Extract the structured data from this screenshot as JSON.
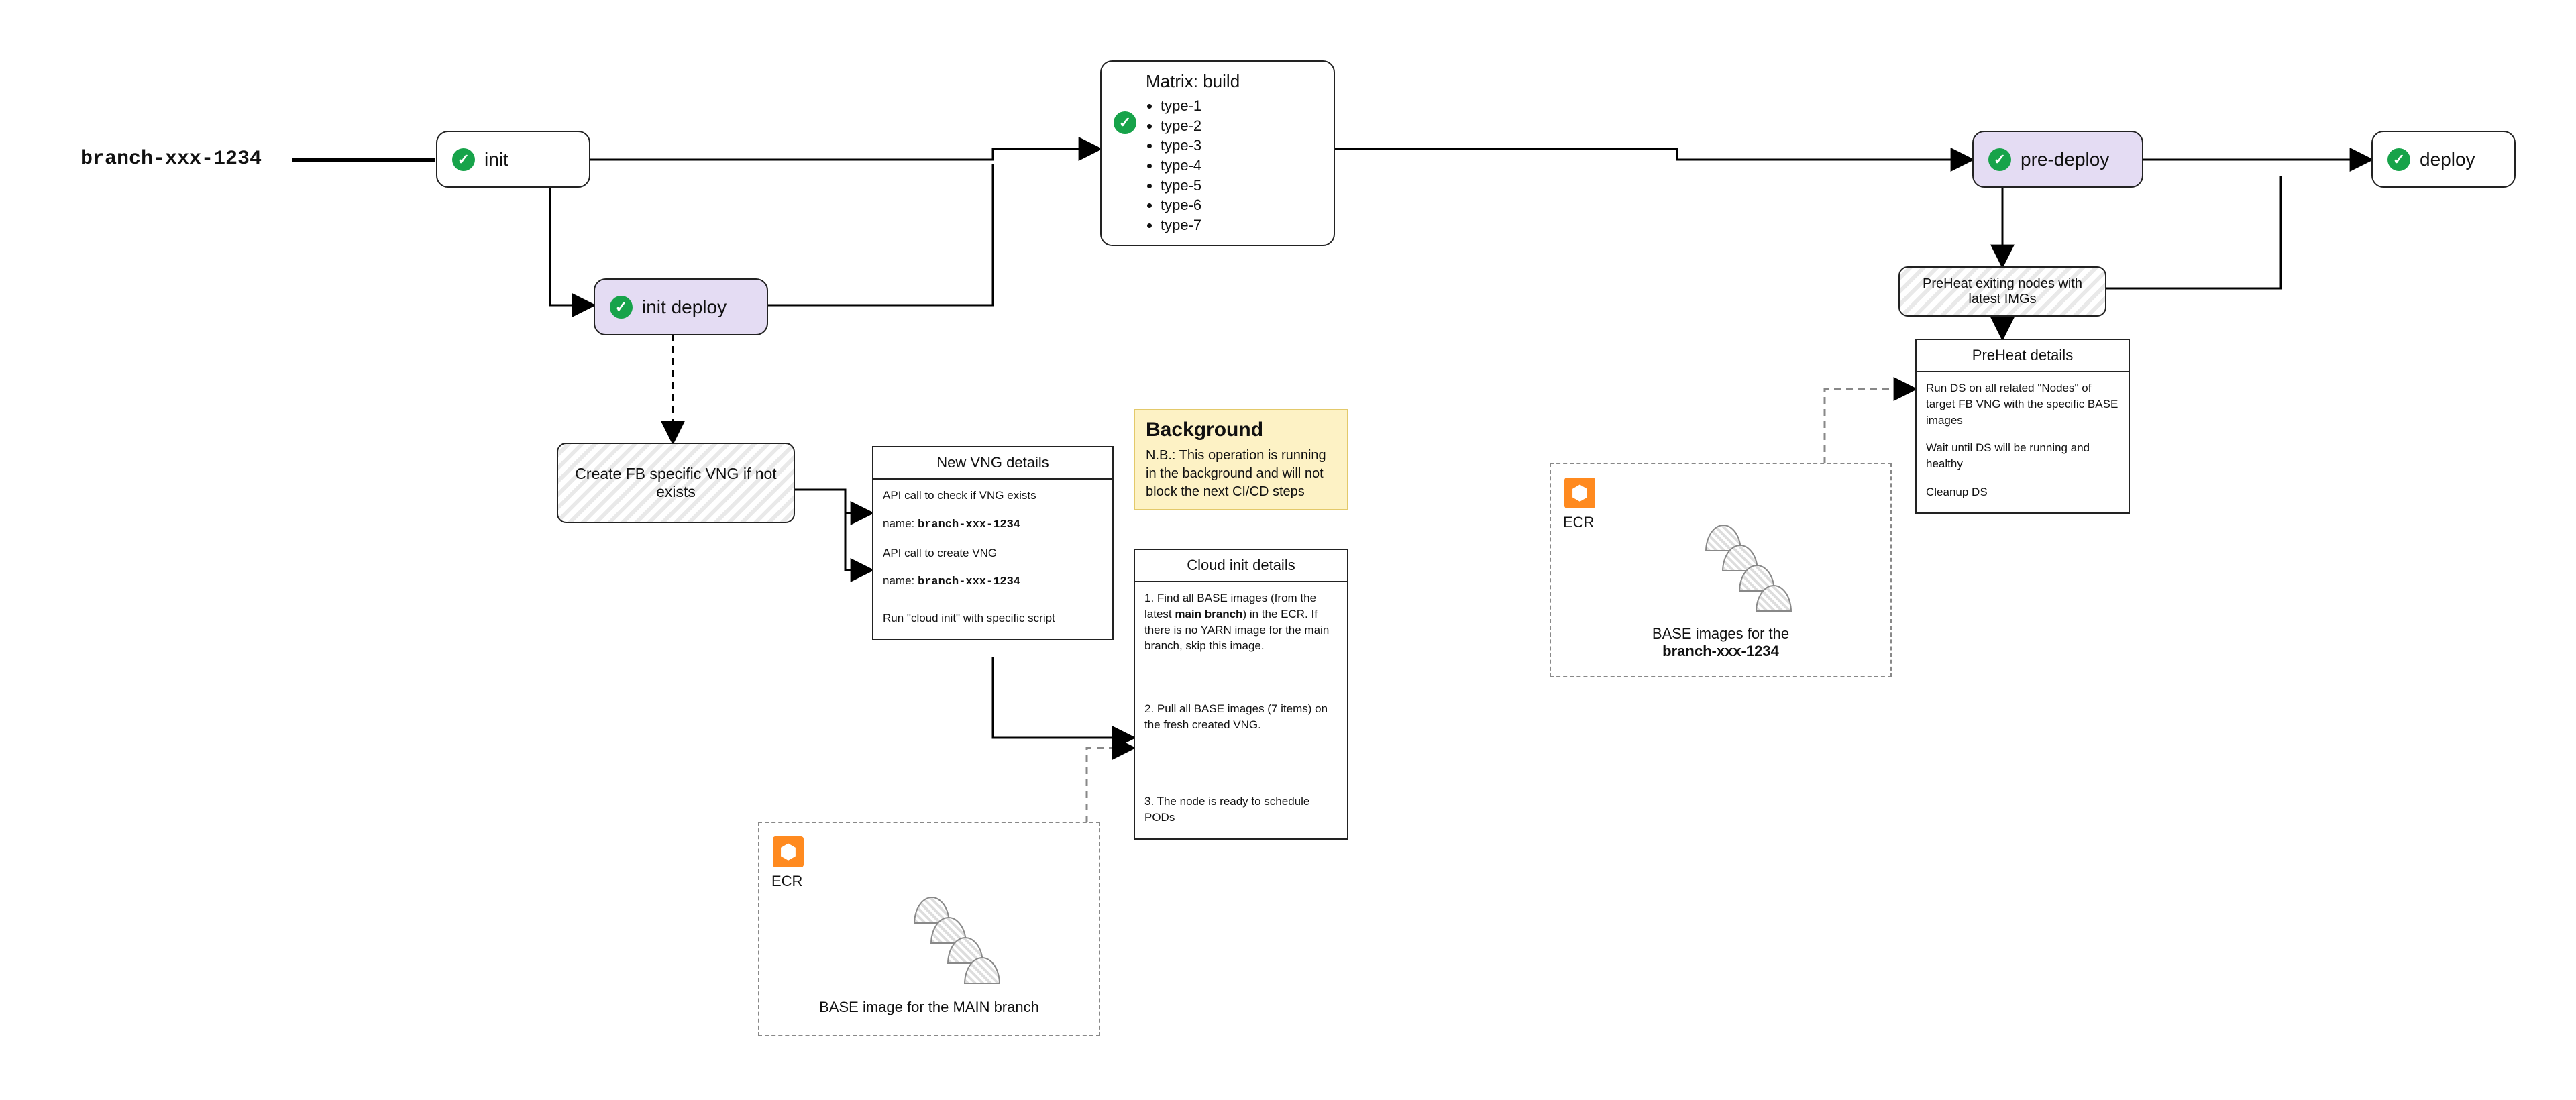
{
  "branch_name": "branch-xxx-1234",
  "nodes": {
    "init": "init",
    "init_deploy": "init deploy",
    "pre_deploy": "pre-deploy",
    "deploy": "deploy"
  },
  "matrix": {
    "title": "Matrix: build",
    "items": [
      "type-1",
      "type-2",
      "type-3",
      "type-4",
      "type-5",
      "type-6",
      "type-7"
    ]
  },
  "create_vng_box": "Create FB specific VNG if not exists",
  "vng_panel": {
    "title": "New VNG details",
    "l1": "API call to check if VNG exists",
    "name_lbl": "name: ",
    "name": "branch-xxx-1234",
    "l2": "API call to create VNG",
    "l3": "Run \"cloud init\" with specific script"
  },
  "bg_note": {
    "title": "Background",
    "body": "N.B.: This operation is running in the background and will not block the next CI/CD steps"
  },
  "cloud_panel": {
    "title": "Cloud init details",
    "p1a": "1. Find all BASE images (from the latest ",
    "p1_bold": "main branch",
    "p1b": ") in the ECR. If there is no YARN image for the main branch, skip this image.",
    "p2": "2. Pull all BASE images (7 items) on the fresh created VNG.",
    "p3": "3. The node is ready to schedule PODs"
  },
  "preheat_box": "PreHeat exiting nodes with latest IMGs",
  "preheat_panel": {
    "title": "PreHeat details",
    "p1": "Run DS on all related \"Nodes\" of target FB VNG with the specific BASE images",
    "p2": "Wait until DS will be running and healthy",
    "p3": "Cleanup DS"
  },
  "ecr": {
    "label": "ECR",
    "main_cap": "BASE image for the MAIN branch",
    "branch_cap_a": "BASE images for the",
    "branch_cap_b": "branch-xxx-1234"
  }
}
